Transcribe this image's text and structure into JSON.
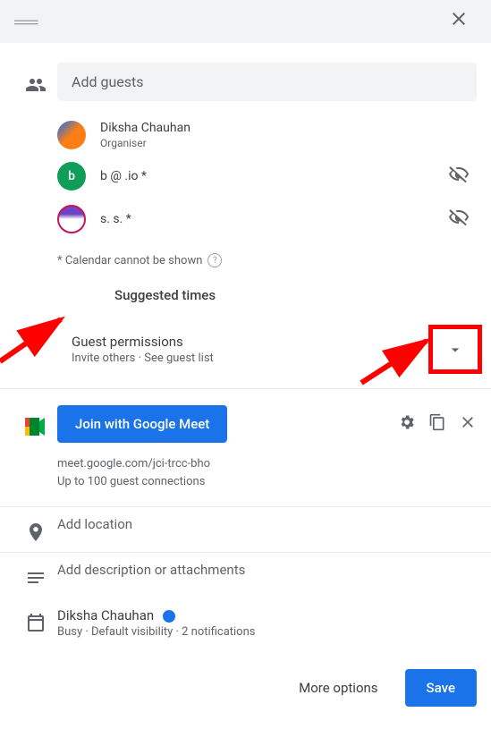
{
  "header": {},
  "guests": {
    "placeholder": "Add guests",
    "items": [
      {
        "name": "Diksha Chauhan",
        "role": "Organiser"
      },
      {
        "name": "b    @       .io *",
        "role": ""
      },
      {
        "name": "s. s. *",
        "role": ""
      }
    ],
    "note": "* Calendar cannot be shown",
    "suggested": "Suggested times"
  },
  "permissions": {
    "title": "Guest permissions",
    "sub": "Invite others · See guest list"
  },
  "meet": {
    "button": "Join with Google Meet",
    "url": "meet.google.com/jci-trcc-bho",
    "capacity": "Up to 100 guest connections"
  },
  "location": {
    "placeholder": "Add location"
  },
  "description": {
    "placeholder": "Add description or attachments"
  },
  "owner": {
    "name": "Diksha Chauhan",
    "sub": "Busy · Default visibility · 2 notifications"
  },
  "footer": {
    "more": "More options",
    "save": "Save"
  }
}
